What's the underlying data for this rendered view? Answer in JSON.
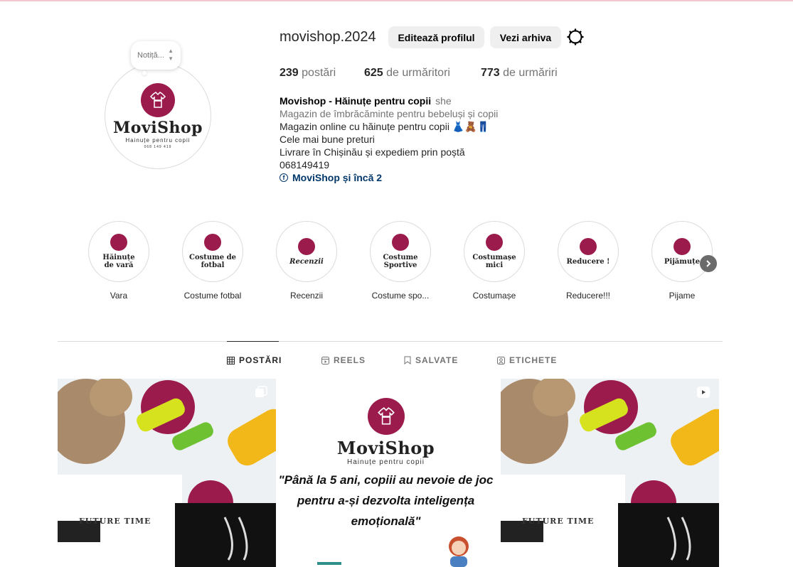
{
  "profile": {
    "username": "movishop.2024",
    "edit_button": "Editează profilul",
    "archive_button": "Vezi arhiva",
    "note_placeholder": "Notiță...",
    "logo": {
      "brand": "MoviShop",
      "tagline": "Hainuțe pentru copii",
      "phone": "068 149 419"
    },
    "stats": [
      {
        "count": "239",
        "label": "postări"
      },
      {
        "count": "625",
        "label": "de urmăritori"
      },
      {
        "count": "773",
        "label": "de urmăriri"
      }
    ],
    "bio": {
      "name": "Movishop - Hăinuțe pentru copii",
      "pronouns": "she",
      "category": "Magazin de îmbrăcăminte pentru bebeluși și copii",
      "lines": [
        "Magazin online cu hăinuțe pentru copii 👗🧸👖",
        "Cele mai bune preturi",
        "Livrare în Chișinău și expediem prin poștă",
        "068149419"
      ],
      "links": "MoviShop și încă 2"
    }
  },
  "highlights": [
    {
      "cover_text": "Hăinuțe\nde vară",
      "label": "Vara"
    },
    {
      "cover_text": "Costume de\nfotbal",
      "label": "Costume fotbal"
    },
    {
      "cover_text": "Recenzii",
      "label": "Recenzii"
    },
    {
      "cover_text": "Costume\nSportive",
      "label": "Costume spo..."
    },
    {
      "cover_text": "Costumașe\nmici",
      "label": "Costumașe"
    },
    {
      "cover_text": "Reducere !",
      "label": "Reducere!!!"
    },
    {
      "cover_text": "Pijămuțe",
      "label": "Pijame"
    }
  ],
  "tabs": [
    "POSTĂRI",
    "REELS",
    "SALVATE",
    "ETICHETE"
  ],
  "posts": {
    "post1_text": "FUTURE TIME",
    "post2_brand": "MoviShop",
    "post2_tagline": "Hainuțe pentru copii",
    "post2_quote": "\"Până la 5 ani, copiii au nevoie de joc pentru a-și dezvolta inteligența emoțională\"",
    "post3_text": "FUTURE TIME"
  },
  "colors": {
    "brand": "#9b1b4d",
    "link": "#00376b"
  }
}
